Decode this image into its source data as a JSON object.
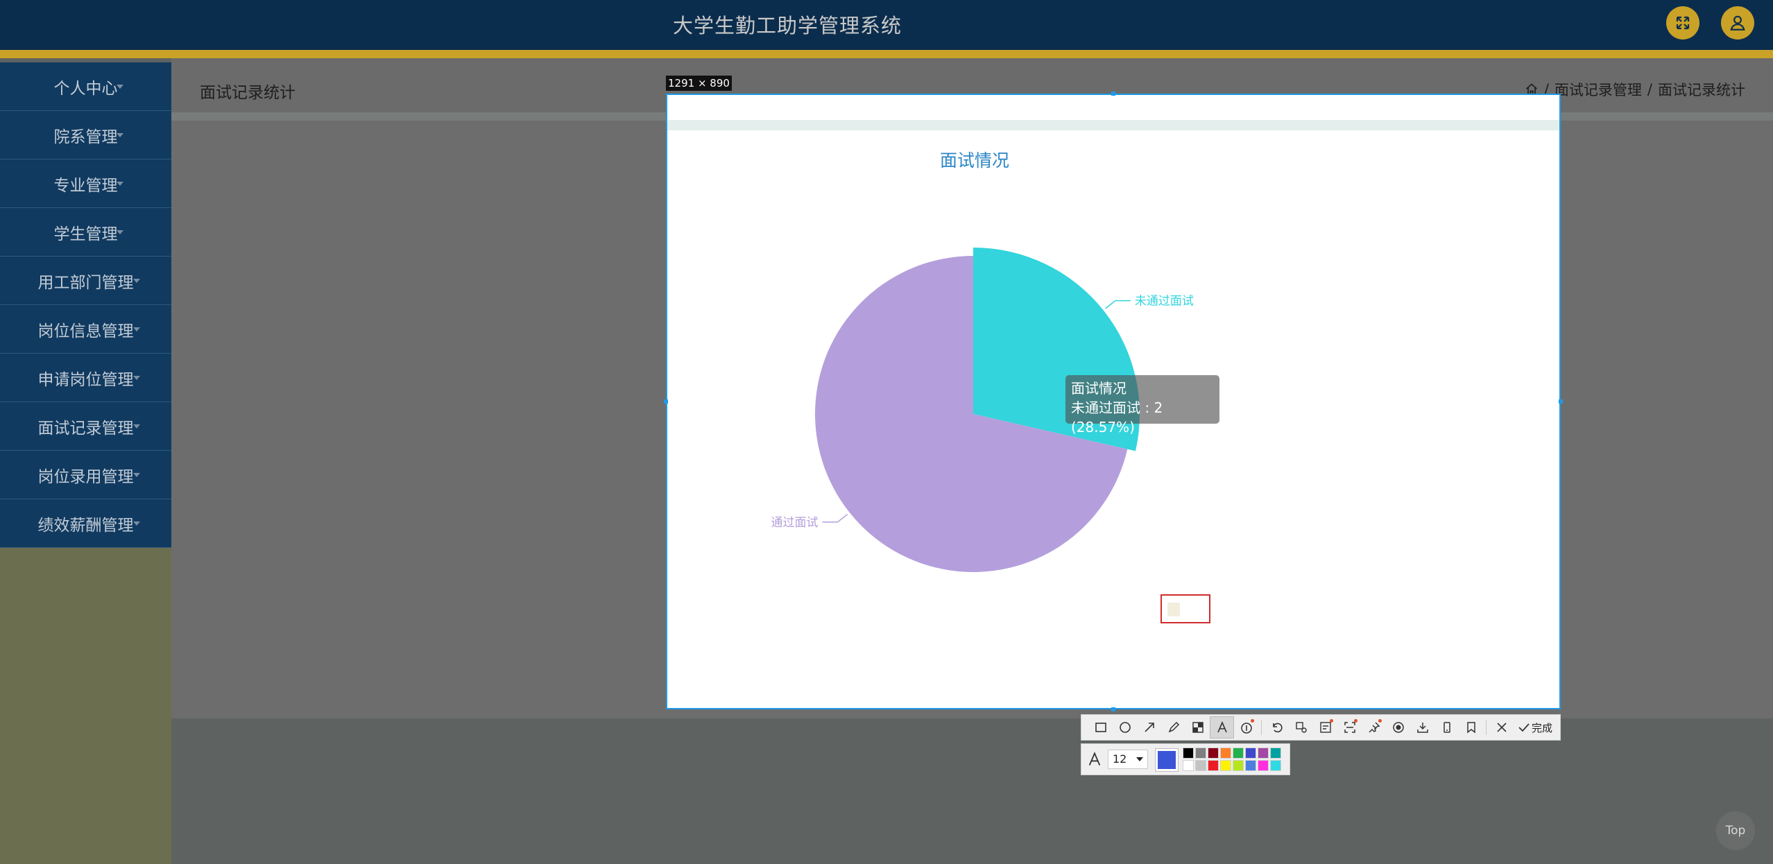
{
  "app": {
    "title": "大学生勤工助学管理系统"
  },
  "sidebar": {
    "items": [
      {
        "label": "个人中心"
      },
      {
        "label": "院系管理"
      },
      {
        "label": "专业管理"
      },
      {
        "label": "学生管理"
      },
      {
        "label": "用工部门管理"
      },
      {
        "label": "岗位信息管理"
      },
      {
        "label": "申请岗位管理"
      },
      {
        "label": "面试记录管理"
      },
      {
        "label": "岗位录用管理"
      },
      {
        "label": "绩效薪酬管理"
      }
    ]
  },
  "page": {
    "title": "面试记录统计",
    "breadcrumb": [
      "面试记录管理",
      "面试记录统计"
    ],
    "breadcrumb_sep": "/"
  },
  "capture": {
    "dimensions": "1291 × 890"
  },
  "chart_data": {
    "type": "pie",
    "title": "面试情况",
    "slices": [
      {
        "name": "未通过面试",
        "value": 2,
        "percent": 28.57,
        "color": "#33d4dc"
      },
      {
        "name": "通过面试",
        "value": 5,
        "percent": 71.43,
        "color": "#b49fdc"
      }
    ],
    "tooltip": {
      "title": "面试情况",
      "line": "未通过面试 : 2 (28.57%)"
    }
  },
  "toolbar": {
    "done_label": "完成",
    "font_size": "12",
    "current_color": "#3a55d6",
    "palette": [
      "#000000",
      "#7f7f7f",
      "#880015",
      "#ff7f27",
      "#22b14c",
      "#3f48cc",
      "#a349a4",
      "#00a2a0",
      "#ffffff",
      "#c3c3c3",
      "#ed1c24",
      "#fff200",
      "#b5e61d",
      "#4a7fe0",
      "#ff2fe0",
      "#30d9e6"
    ]
  },
  "back_to_top": {
    "label": "Top"
  }
}
